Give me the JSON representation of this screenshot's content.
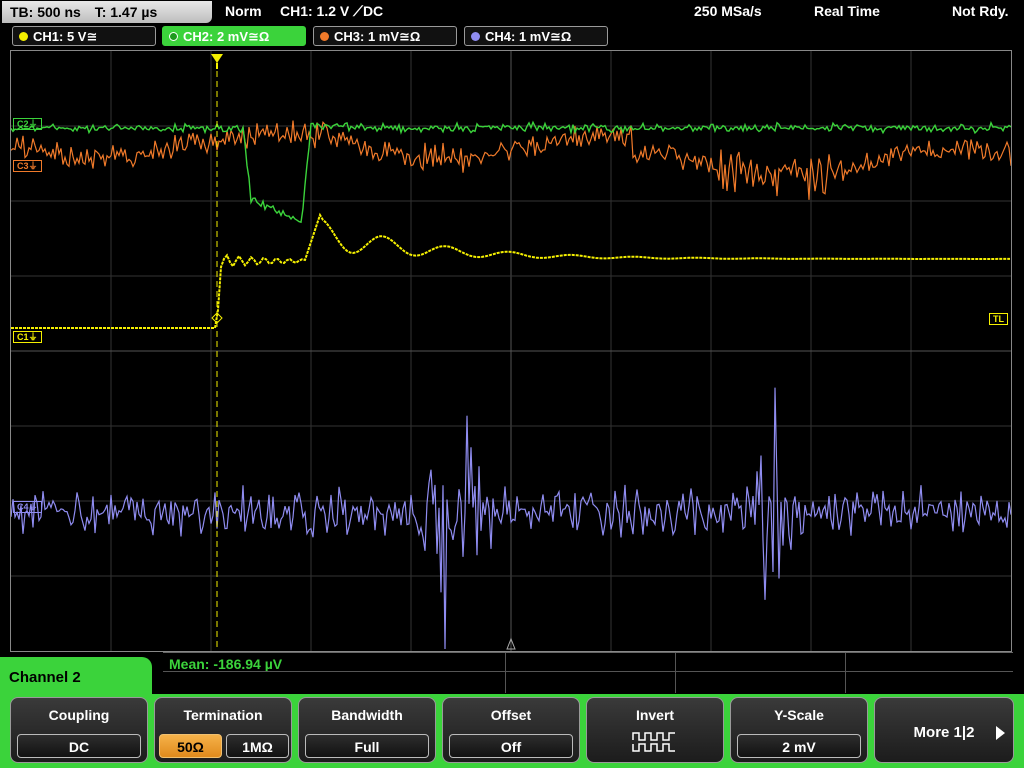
{
  "topbar": {
    "timebase": "TB: 500 ns",
    "trigger_time": "T: 1.47 µs",
    "mode": "Norm",
    "trigger_info": "CH1: 1.2 V ⟋DC",
    "sample_rate": "250 MSa/s",
    "acq_mode": "Real Time",
    "status": "Not Rdy."
  },
  "channels": [
    {
      "label": "CH1: 5 V≅",
      "color": "#f5f000"
    },
    {
      "label": "CH2: 2 mV≅Ω",
      "color": "#3bd33b"
    },
    {
      "label": "CH3: 1 mV≅Ω",
      "color": "#f07a2a"
    },
    {
      "label": "CH4: 1 mV≅Ω",
      "color": "#8f8cf0"
    }
  ],
  "markers": {
    "c1": "C1⏚",
    "c2": "C2⏚",
    "c3": "C3⏚",
    "c4": "C4⏚",
    "trigger_level": "TL"
  },
  "measurement": {
    "mean": "Mean: -186.94 µV"
  },
  "menu": {
    "title": "Channel 2",
    "coupling": {
      "title": "Coupling",
      "value": "DC"
    },
    "termination": {
      "title": "Termination",
      "opt1": "50Ω",
      "opt2": "1MΩ"
    },
    "bandwidth": {
      "title": "Bandwidth",
      "value": "Full"
    },
    "offset": {
      "title": "Offset",
      "value": "Off"
    },
    "invert": {
      "title": "Invert"
    },
    "yscale": {
      "title": "Y-Scale",
      "value": "2 mV"
    },
    "more": "More 1|2"
  }
}
